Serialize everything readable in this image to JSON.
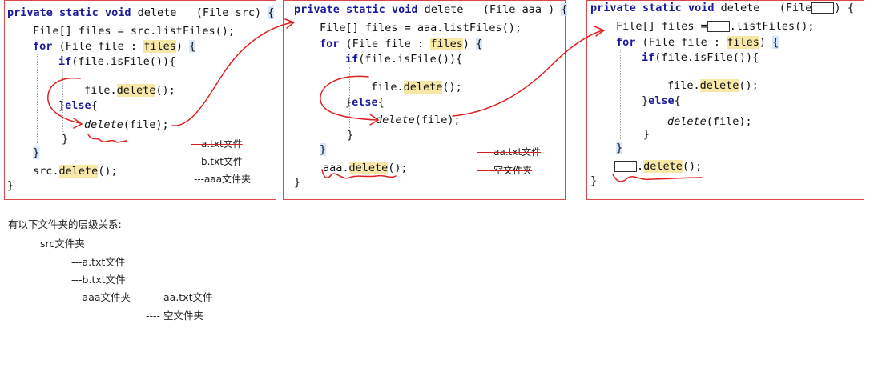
{
  "panel1": {
    "sig_private": "private",
    "sig_static": "static",
    "sig_void": "void",
    "sig_name": "delete",
    "sig_param": "(File src)",
    "line_files_decl": "File[] files = src.listFiles();",
    "for_kw": "for",
    "for_open": "(File file :",
    "for_files": "files",
    "for_close": ")",
    "if_kw": "if",
    "if_cond": "(file.isFile()){",
    "call_obj": "file.",
    "call_method": "delete",
    "call_args": "();",
    "else_open": "}",
    "else_kw": "else",
    "else_brace": "{",
    "recur_name": "delete",
    "recur_args": "(file);",
    "inner_close": "}",
    "for_end": "}",
    "final_obj": "src.",
    "final_method": "delete",
    "final_args": "();",
    "method_close": "}",
    "ann_atxt": "---a.txt文件",
    "ann_btxt": "---b.txt文件",
    "ann_aaa": "---aaa文件夹"
  },
  "panel2": {
    "sig_private": "private",
    "sig_static": "static",
    "sig_void": "void",
    "sig_name": "delete",
    "sig_param": "(File aaa )",
    "line_files_decl": "File[] files = aaa.listFiles();",
    "for_kw": "for",
    "for_open": "(File file :",
    "for_files": "files",
    "for_close": ")",
    "if_kw": "if",
    "if_cond": "(file.isFile()){",
    "call_obj": "file.",
    "call_method": "delete",
    "call_args": "();",
    "else_open": "}",
    "else_kw": "else",
    "else_brace": "{",
    "recur_name": "delete",
    "recur_args": "(file);",
    "inner_close": "}",
    "for_end": "}",
    "final_obj": "aaa.",
    "final_method": "delete",
    "final_args": "();",
    "method_close": "}",
    "ann_aatxt": "---- aa.txt文件",
    "ann_empty": "---- 空文件夹"
  },
  "panel3": {
    "sig_private": "private",
    "sig_static": "static",
    "sig_void": "void",
    "sig_name": "delete",
    "sig_param_open": "(File",
    "sig_param_close": ") {",
    "line_files_prefix": "File[] files =",
    "line_files_suffix": ".listFiles();",
    "for_kw": "for",
    "for_open": "(File file :",
    "for_files": "files",
    "for_close": ")",
    "if_kw": "if",
    "if_cond": "(file.isFile()){",
    "call_obj": "file.",
    "call_method": "delete",
    "call_args": "();",
    "else_open": "}",
    "else_kw": "else",
    "else_brace": "{",
    "recur_name": "delete",
    "recur_args": "(file);",
    "inner_close": "}",
    "for_end": "}",
    "final_method": "delete",
    "final_args": "();",
    "method_close": "}"
  },
  "hierarchy": {
    "heading": "有以下文件夹的层级关系:",
    "root": "src文件夹",
    "a_txt": "---a.txt文件",
    "b_txt": "---b.txt文件",
    "aaa": "---aaa文件夹",
    "aa_txt": "---- aa.txt文件",
    "empty": "---- 空文件夹"
  },
  "colors": {
    "border": "#d84a4a",
    "keyword": "#1a1a9c",
    "highlight": "#f7e8a8",
    "bracket": "#d6e6fb",
    "handwriting": "#e02020"
  }
}
